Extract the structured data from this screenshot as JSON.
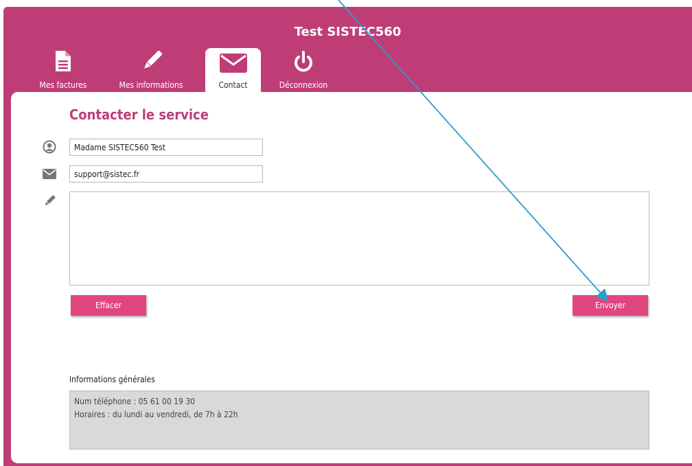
{
  "header": {
    "title": "Test SISTEC560"
  },
  "tabs": [
    {
      "label": "Mes factures",
      "icon": "document-icon"
    },
    {
      "label": "Mes informations",
      "icon": "pencil-icon"
    },
    {
      "label": "Contact",
      "icon": "envelope-icon",
      "active": true
    },
    {
      "label": "Déconnexion",
      "icon": "power-icon"
    }
  ],
  "form": {
    "heading": "Contacter le service",
    "name_value": "Madame SISTEC560 Test",
    "email_value": "support@sistec.fr",
    "message_value": "",
    "clear_label": "Effacer",
    "send_label": "Envoyer"
  },
  "info": {
    "label": "Informations générales",
    "phone": "Num téléphone : 05 61 00 19 30",
    "hours": "Horaires : du lundi au vendredi, de 7h à 22h"
  },
  "colors": {
    "brand": "#bf3d77",
    "button": "#e0467f",
    "annotation_arrow": "#2a9ec6"
  }
}
